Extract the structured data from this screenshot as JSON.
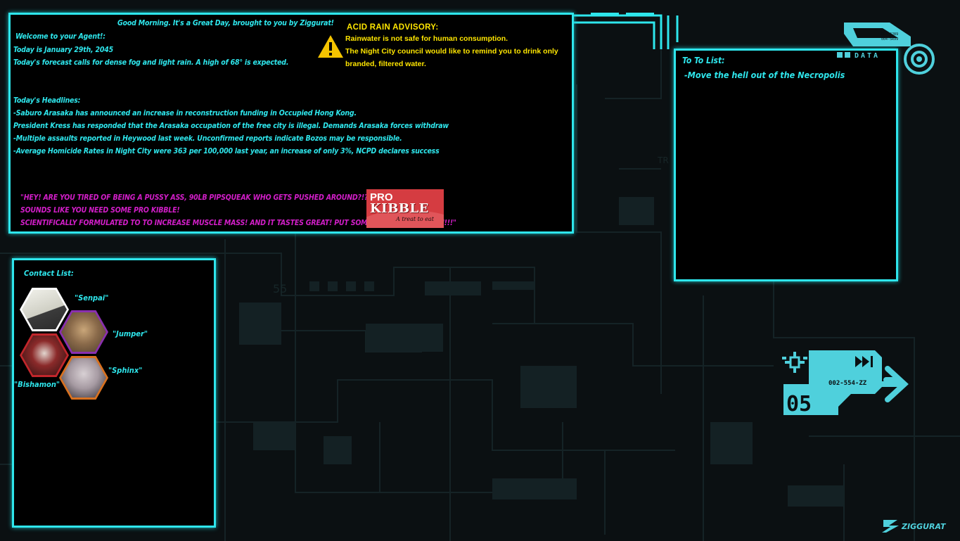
{
  "colors": {
    "accent": "#2ee6ec",
    "warning": "#ffe600",
    "ad_text": "#d21ec8",
    "panel_bg": "#000000",
    "background": "#0a0e0f"
  },
  "news": {
    "greeting": "Good Morning.  It's a Great Day, brought to you by Ziggurat!",
    "welcome": "Welcome to your Agent!:",
    "date": "Today is January 29th, 2045",
    "forecast": "Today's forecast calls for dense fog and light rain.  A high of 68° is expected.",
    "headlines_title": "Today's Headlines:",
    "headlines": [
      "-Saburo Arasaka has announced an increase in reconstruction funding in Occupied Hong Kong.",
      "President Kress has responded that the Arasaka occupation of the free city is illegal. Demands Arasaka forces withdraw",
      "-Multiple assaults reported in Heywood last week.  Unconfirmed reports indicate Bozos may be responsible.",
      "-Average Homicide Rates in Night City were 363 per 100,000 last year, an increase of only 3%, NCPD declares success"
    ]
  },
  "advisory": {
    "icon": "warning-triangle-icon",
    "title": "ACID RAIN ADVISORY:",
    "lines": [
      "Rainwater is not safe for human consumption.",
      "The Night City council would like to remind you to drink only branded, filtered water."
    ]
  },
  "ad": {
    "lines": [
      "\"HEY! ARE YOU TIRED OF BEING A PUSSY ASS, 90LB PIPSQUEAK WHO GETS PUSHED AROUND?!?!",
      "SOUNDS LIKE YOU NEED SOME PRO KIBBLE!",
      "SCIENTIFICALLY FORMULATED TO TO INCREASE MUSCLE MASS!  AND IT TASTES GREAT! PUT SOME PRO KIBBLE IN YOU!!!\""
    ],
    "logo_pro": "PRO",
    "logo_kibble": "KIBBLE",
    "logo_tagline": "A treat to eat"
  },
  "todo": {
    "title": "To To List:",
    "items": [
      "-Move the hell out of the Necropolis"
    ]
  },
  "contacts": {
    "title": "Contact List:",
    "items": [
      {
        "name": "\"Senpai\"",
        "avatar_color": "#d9d9d0"
      },
      {
        "name": "\"Jumper\"",
        "avatar_color": "#8a6a4a"
      },
      {
        "name": "\"Bishamon\"",
        "avatar_color": "#7a2626"
      },
      {
        "name": "\"Sphinx\"",
        "avatar_color": "#b8b0b6"
      }
    ]
  },
  "hud": {
    "top_label": "DATA",
    "top_small_1": "004-JJ89",
    "top_small_2": "004-5R99",
    "badge_number": "05",
    "badge_code": "002-554-ZZ"
  },
  "brand": {
    "logo_text": "ZIGGURAT"
  }
}
